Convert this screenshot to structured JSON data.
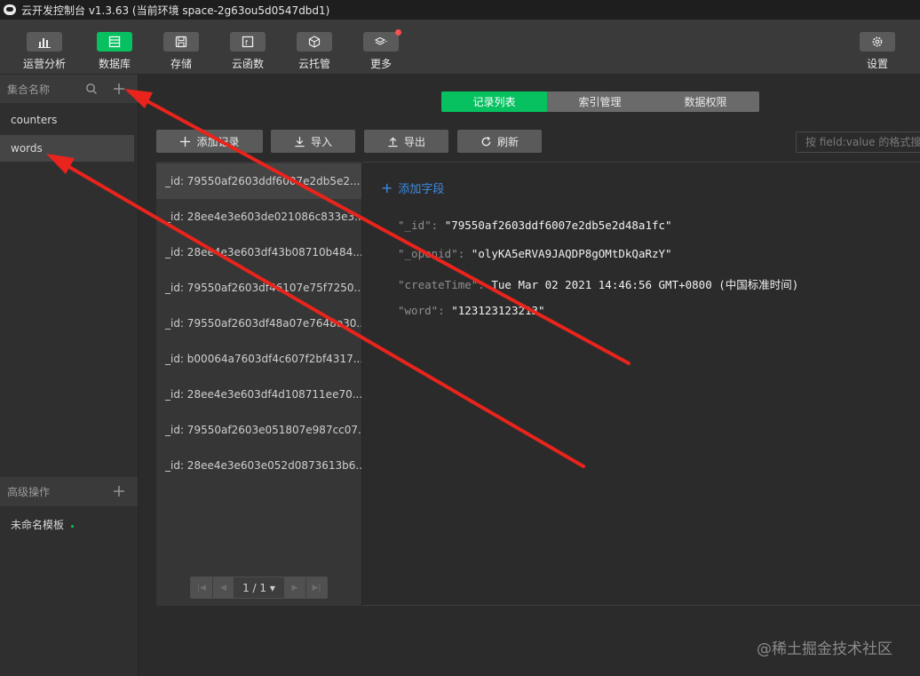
{
  "window": {
    "title": "云开发控制台 v1.3.63 (当前环境 space-2g63ou5d0547dbd1)"
  },
  "toolbar": {
    "items": [
      {
        "label": "运营分析",
        "icon": "bar-chart-icon"
      },
      {
        "label": "数据库",
        "icon": "database-icon",
        "active": true
      },
      {
        "label": "存储",
        "icon": "storage-icon"
      },
      {
        "label": "云函数",
        "icon": "function-icon"
      },
      {
        "label": "云托管",
        "icon": "cube-icon"
      },
      {
        "label": "更多",
        "icon": "layers-icon"
      }
    ],
    "settings_label": "设置"
  },
  "sidebar": {
    "collections_header": "集合名称",
    "collections": [
      {
        "label": "counters"
      },
      {
        "label": "words",
        "active": true
      }
    ],
    "advanced_header": "高级操作",
    "template_label": "未命名模板"
  },
  "tabs": [
    {
      "label": "记录列表",
      "active": true
    },
    {
      "label": "索引管理"
    },
    {
      "label": "数据权限"
    }
  ],
  "actions": {
    "add_record": "添加记录",
    "import": "导入",
    "export": "导出",
    "refresh": "刷新",
    "search_placeholder": "按 field:value 的格式搜"
  },
  "records": [
    "_id: 79550af2603ddf6007e2db5e2...",
    "_id: 28ee4e3e603de021086c833e3...",
    "_id: 28ee4e3e603df43b08710b484...",
    "_id: 79550af2603df46107e75f7250...",
    "_id: 79550af2603df48a07e7648e30...",
    "_id: b00064a7603df4c607f2bf4317...",
    "_id: 28ee4e3e603df4d108711ee70...",
    "_id: 79550af2603e051807e987cc07...",
    "_id: 28ee4e3e603e052d0873613b6..."
  ],
  "pager": {
    "text": "1 / 1 ▾"
  },
  "detail": {
    "add_field_label": "添加字段",
    "fields": [
      {
        "key": "\"_id\":",
        "value": "\"79550af2603ddf6007e2db5e2d48a1fc\""
      },
      {
        "key": "\"_openid\":",
        "value": "\"olyKA5eRVA9JAQDP8gOMtDkQaRzY\""
      },
      {
        "key": "\"createTime\":",
        "value": "Tue Mar 02 2021 14:46:56 GMT+0800 (中国标准时间)"
      },
      {
        "key": "\"word\":",
        "value": "\"123123123213\""
      }
    ]
  },
  "watermark": "@稀土掘金技术社区",
  "colors": {
    "accent": "#07c160",
    "annotation": "#e8241c",
    "link": "#3d8be0"
  }
}
